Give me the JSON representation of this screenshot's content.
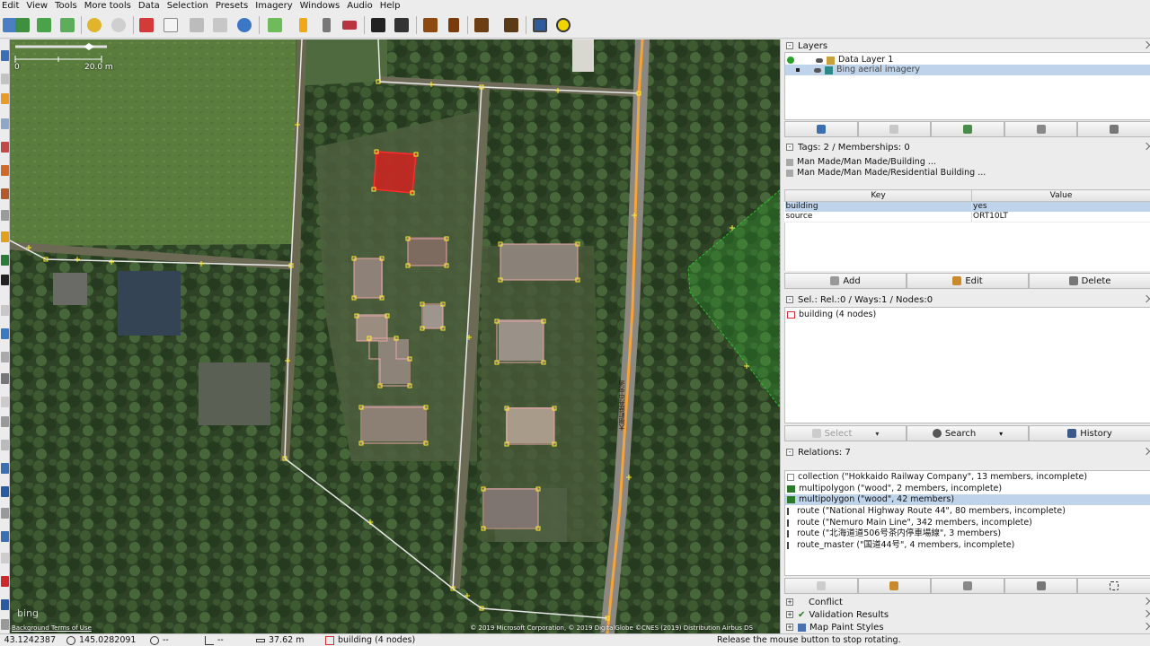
{
  "menu": [
    "Edit",
    "View",
    "Tools",
    "More tools",
    "Data",
    "Selection",
    "Presets",
    "Imagery",
    "Windows",
    "Audio",
    "Help"
  ],
  "toolbar_icons": [
    "open-file-icon",
    "download-icon",
    "upload-icon",
    "undo-icon",
    "redo-icon",
    "preferences-icon",
    "wireframe-icon",
    "zoom-icon",
    "refresh-icon",
    "gear-wheels-icon",
    "traffic-light-icon",
    "parking-icon",
    "car-icon",
    "bus-icon",
    "warning-sign-icon",
    "restaurant-icon",
    "castle-icon",
    "factory-icon",
    "camera-icon",
    "sun-icon"
  ],
  "map": {
    "scale_start": "0",
    "scale_end": "20.0 m",
    "bing_logo": "bing",
    "credit_left": "Background Terms of Use",
    "credit_right": "© 2019 Microsoft Corporation, © 2019 DigitalGlobe ©CNES (2019) Distribution Airbus DS",
    "road_label": "大樹町歴舟中央通"
  },
  "layers": {
    "title": "Layers",
    "items": [
      {
        "name": "Data Layer 1"
      },
      {
        "name": "Bing aerial imagery"
      }
    ]
  },
  "tags": {
    "title": "Tags: 2 / Memberships: 0",
    "presets": [
      "Man Made/Man Made/Building ...",
      "Man Made/Man Made/Residential Building ..."
    ],
    "col_key": "Key",
    "col_value": "Value",
    "rows": [
      {
        "key": "building",
        "value": "yes"
      },
      {
        "key": "source",
        "value": "ORT10LT"
      }
    ],
    "add": "Add",
    "edit": "Edit",
    "delete": "Delete"
  },
  "selection": {
    "title": "Sel.: Rel.:0 / Ways:1 / Nodes:0",
    "items": [
      "building (4 nodes)"
    ],
    "select": "Select",
    "search": "Search",
    "history": "History"
  },
  "relations": {
    "title": "Relations: 7",
    "items": [
      "collection (\"Hokkaido Railway Company\", 13 members, incomplete)",
      "multipolygon (\"wood\", 2 members, incomplete)",
      "multipolygon (\"wood\", 42 members)",
      "route (\"National Highway Route 44\", 80 members, incomplete)",
      "route (\"Nemuro Main Line\", 342 members, incomplete)",
      "route (\"北海道道506号茶内停車場線\", 3 members)",
      "route_master (\"国道44号\", 4 members, incomplete)"
    ]
  },
  "collapsed_panels": [
    "Conflict",
    "Validation Results",
    "Map Paint Styles"
  ],
  "status": {
    "lat": "43.1242387",
    "lon": "145.0282091",
    "heading": "--",
    "angle": "--",
    "distance": "37.62 m",
    "selection": "building (4 nodes)",
    "message": "Release the mouse button to stop rotating."
  },
  "colors": {
    "selected_building": "#d81e1e",
    "building_outline": "#e8a5a5",
    "node": "#ffee33",
    "road_primary": "#ffa53b",
    "wood_area": "#2fbf2f"
  }
}
